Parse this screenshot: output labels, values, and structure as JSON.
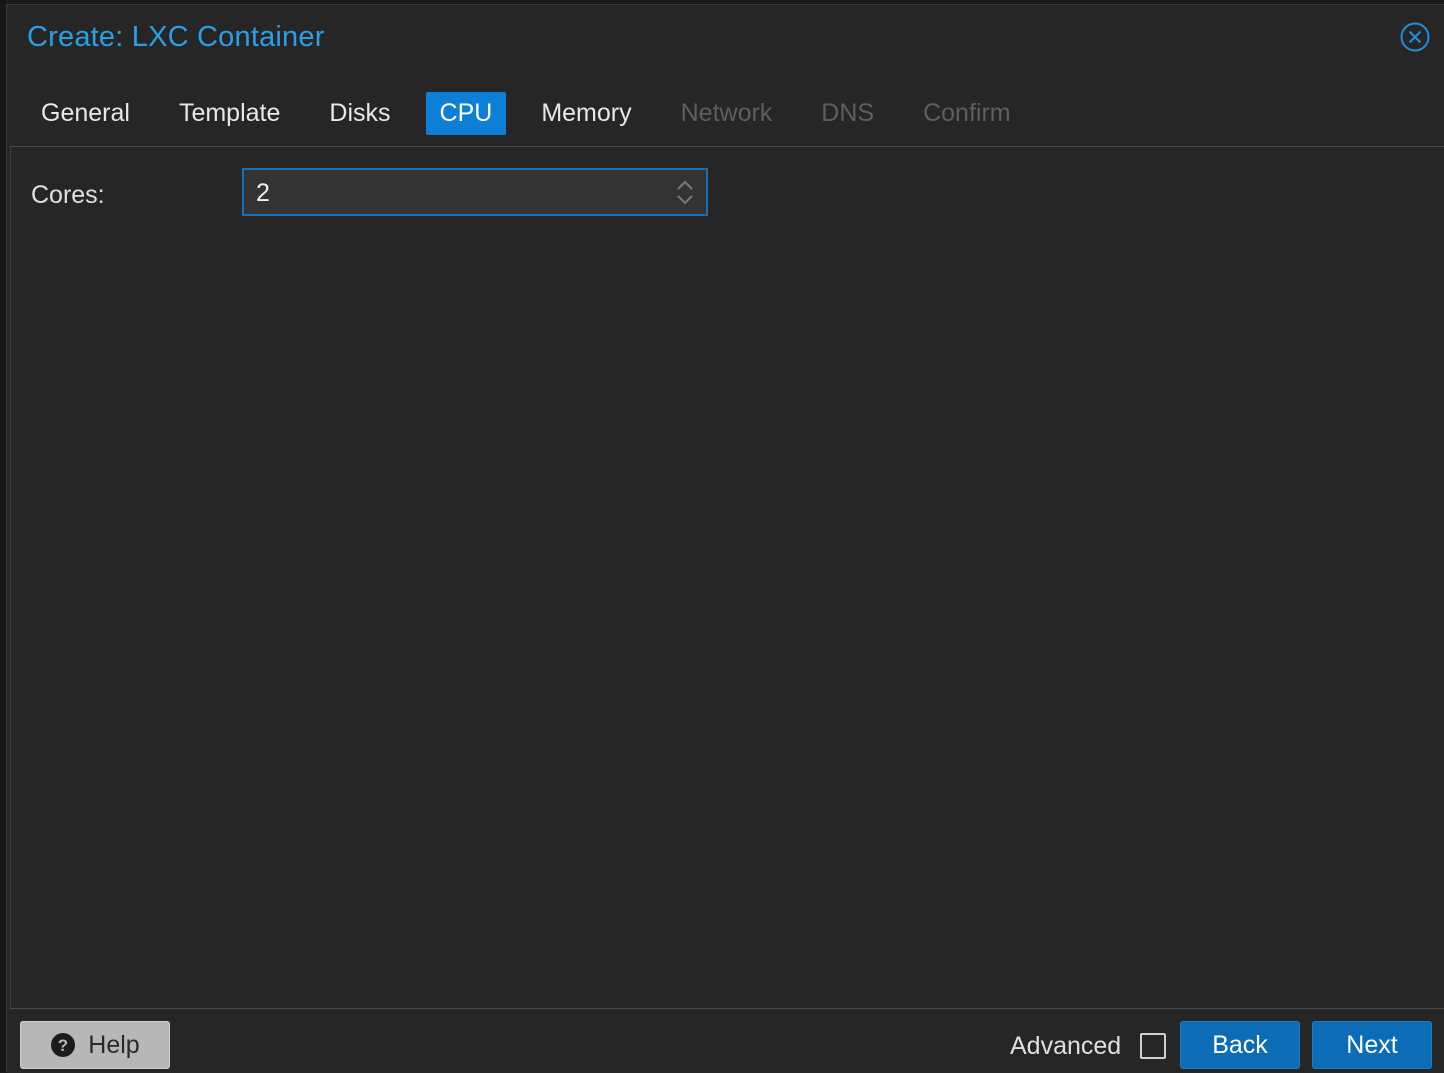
{
  "dialog": {
    "title": "Create: LXC Container",
    "close_icon": "close-circle-icon"
  },
  "tabs": [
    {
      "label": "General",
      "state": "normal"
    },
    {
      "label": "Template",
      "state": "normal"
    },
    {
      "label": "Disks",
      "state": "normal"
    },
    {
      "label": "CPU",
      "state": "active"
    },
    {
      "label": "Memory",
      "state": "normal"
    },
    {
      "label": "Network",
      "state": "disabled"
    },
    {
      "label": "DNS",
      "state": "disabled"
    },
    {
      "label": "Confirm",
      "state": "disabled"
    }
  ],
  "cpu": {
    "cores_label": "Cores:",
    "cores_value": "2"
  },
  "footer": {
    "help_label": "Help",
    "help_icon": "question-circle-icon",
    "advanced_label": "Advanced",
    "advanced_checked": false,
    "back_label": "Back",
    "next_label": "Next"
  },
  "colors": {
    "accent": "#0e7fd6",
    "title": "#2b9fe6",
    "background": "#262626",
    "disabled_text": "#5e5e5e"
  }
}
